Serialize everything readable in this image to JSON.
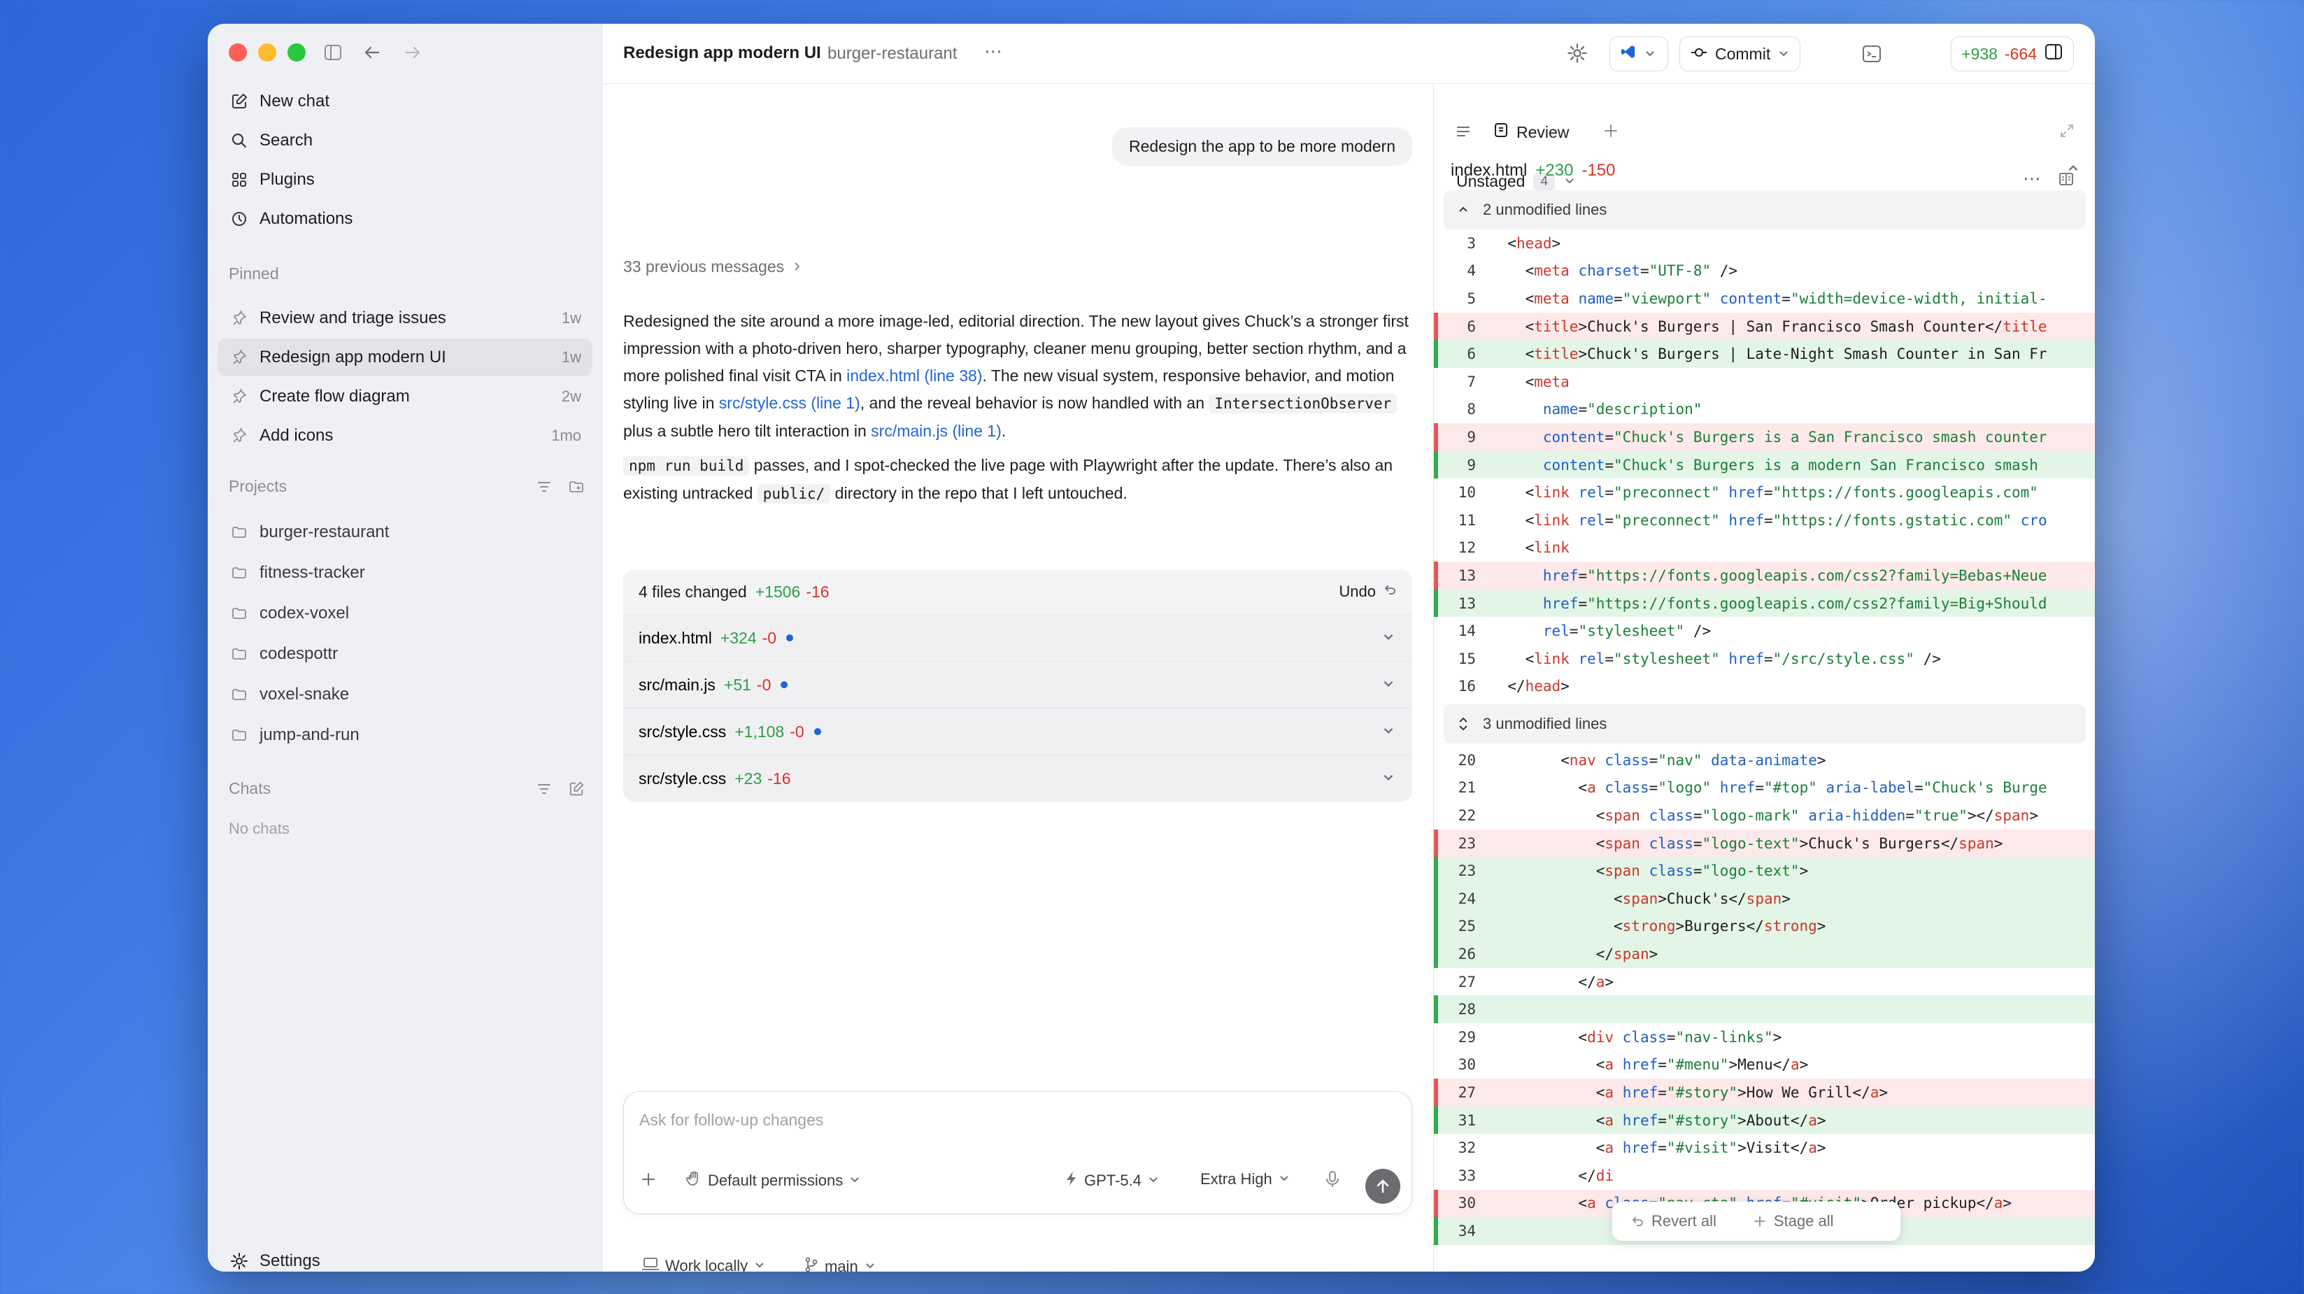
{
  "sidebar": {
    "nav": [
      {
        "label": "New chat",
        "icon": "compose-icon"
      },
      {
        "label": "Search",
        "icon": "search-icon"
      },
      {
        "label": "Plugins",
        "icon": "grid-icon"
      },
      {
        "label": "Automations",
        "icon": "clock-icon"
      }
    ],
    "pinned_label": "Pinned",
    "pinned": [
      {
        "label": "Review and triage issues",
        "when": "1w"
      },
      {
        "label": "Redesign app modern UI",
        "when": "1w"
      },
      {
        "label": "Create flow diagram",
        "when": "2w"
      },
      {
        "label": "Add icons",
        "when": "1mo"
      }
    ],
    "projects_label": "Projects",
    "projects": [
      "burger-restaurant",
      "fitness-tracker",
      "codex-voxel",
      "codespottr",
      "voxel-snake",
      "jump-and-run"
    ],
    "chats_label": "Chats",
    "no_chats": "No chats",
    "settings": "Settings"
  },
  "header": {
    "title": "Redesign app modern UI",
    "project": "burger-restaurant",
    "commit_label": "Commit",
    "additions": "+938",
    "deletions": "-664"
  },
  "chat": {
    "user_message": "Redesign the app to be more modern",
    "previous_messages": "33 previous messages",
    "p1_a": "Redesigned the site around a more image-led, editorial direction. The new layout gives Chuck’s a stronger first impression with a photo-driven hero, sharper typography, cleaner menu grouping, better section rhythm, and a more polished final visit CTA in ",
    "p1_link1": "index.html (line 38)",
    "p1_b": ". The new visual system, responsive behavior, and motion styling live in ",
    "p1_link2": "src/style.css (line 1)",
    "p1_c": ", and the reveal behavior is now handled with an ",
    "p1_code": "IntersectionObserver",
    "p1_d": " plus a subtle hero tilt interaction in ",
    "p1_link3": "src/main.js (line 1)",
    "p1_e": ".",
    "p2_code1": "npm run build",
    "p2_a": " passes, and I spot-checked the live page with Playwright after the update. There’s also an existing untracked ",
    "p2_code2": "public/",
    "p2_b": " directory in the repo that I left untouched."
  },
  "files_changed": {
    "summary": "4 files changed",
    "plus": "+1506",
    "minus": "-16",
    "undo": "Undo",
    "files": [
      {
        "name": "index.html",
        "plus": "+324",
        "minus": "-0",
        "dot": true
      },
      {
        "name": "src/main.js",
        "plus": "+51",
        "minus": "-0",
        "dot": true
      },
      {
        "name": "src/style.css",
        "plus": "+1,108",
        "minus": "-0",
        "dot": true
      },
      {
        "name": "src/style.css",
        "plus": "+23",
        "minus": "-16",
        "dot": false
      }
    ]
  },
  "composer": {
    "placeholder": "Ask for follow-up changes",
    "permissions": "Default permissions",
    "model": "GPT-5.4",
    "effort": "Extra High",
    "work_mode": "Work locally",
    "branch": "main"
  },
  "review": {
    "tab": "Review",
    "unstaged": "Unstaged",
    "unstaged_count": "4",
    "file": "index.html",
    "file_plus": "+230",
    "file_minus": "-150",
    "unmod1": "2 unmodified lines",
    "unmod2": "3 unmodified lines",
    "revert_all": "Revert all",
    "stage_all": "Stage all"
  },
  "colors": {
    "added": "#34a853",
    "removed": "#e05a5a",
    "link": "#1f65d6",
    "accent": "#1f65d6"
  }
}
